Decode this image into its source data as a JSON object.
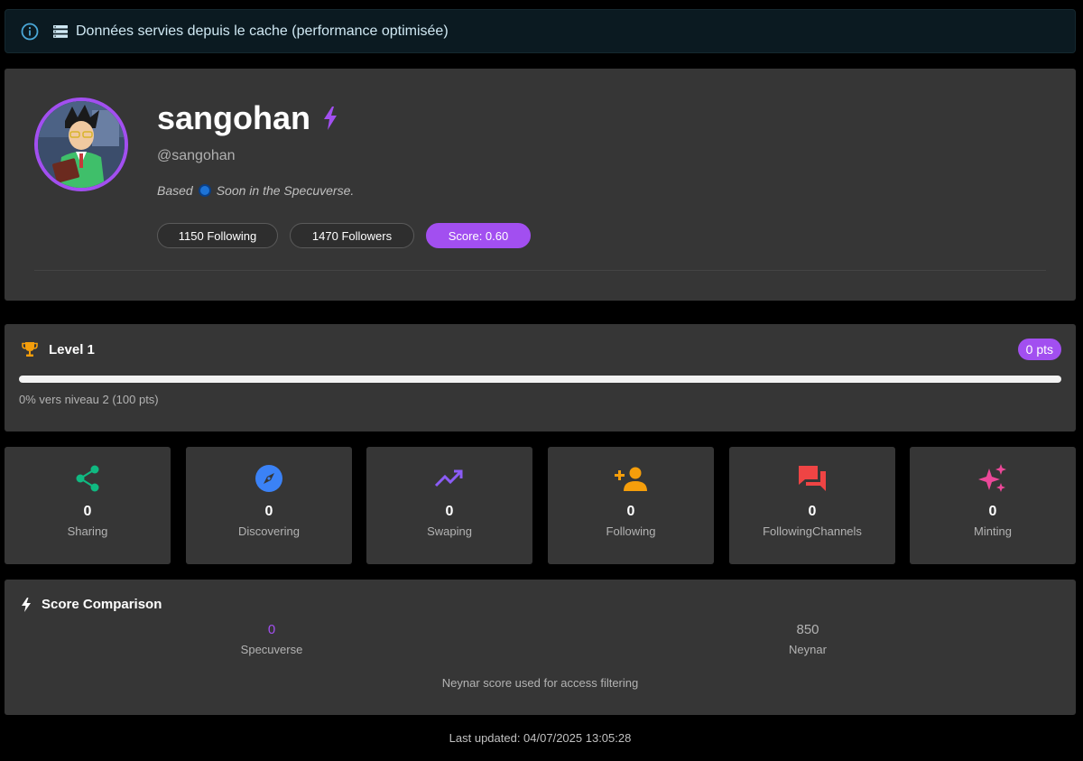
{
  "banner": {
    "text": "Données servies depuis le cache (performance optimisée)",
    "icons": [
      "info-icon",
      "database-icon"
    ]
  },
  "profile": {
    "name": "sangohan",
    "handle": "@sangohan",
    "bio_prefix": "Based",
    "bio_suffix": "Soon in the Specuverse.",
    "following_label": "1150 Following",
    "followers_label": "1470 Followers",
    "score_label": "Score: 0.60",
    "accent": "#a24ff0"
  },
  "level": {
    "title": "Level 1",
    "points": "0 pts",
    "progress_text": "0% vers niveau 2 (100 pts)",
    "progress_fraction": 0
  },
  "stats": [
    {
      "value": "0",
      "label": "Sharing",
      "icon": "share-icon",
      "color": "#10b981"
    },
    {
      "value": "0",
      "label": "Discovering",
      "icon": "compass-icon",
      "color": "#3b82f6"
    },
    {
      "value": "0",
      "label": "Swaping",
      "icon": "trending-up-icon",
      "color": "#8b5cf6"
    },
    {
      "value": "0",
      "label": "Following",
      "icon": "person-add-icon",
      "color": "#f59e0b"
    },
    {
      "value": "0",
      "label": "FollowingChannels",
      "icon": "chat-bubbles-icon",
      "color": "#ef4444"
    },
    {
      "value": "0",
      "label": "Minting",
      "icon": "sparkles-icon",
      "color": "#ec4899"
    }
  ],
  "comparison": {
    "title": "Score Comparison",
    "specuverse_value": "0",
    "specuverse_label": "Specuverse",
    "neynar_value": "850",
    "neynar_label": "Neynar",
    "note": "Neynar score used for access filtering"
  },
  "footer": {
    "last_updated": "Last updated: 04/07/2025 13:05:28"
  }
}
